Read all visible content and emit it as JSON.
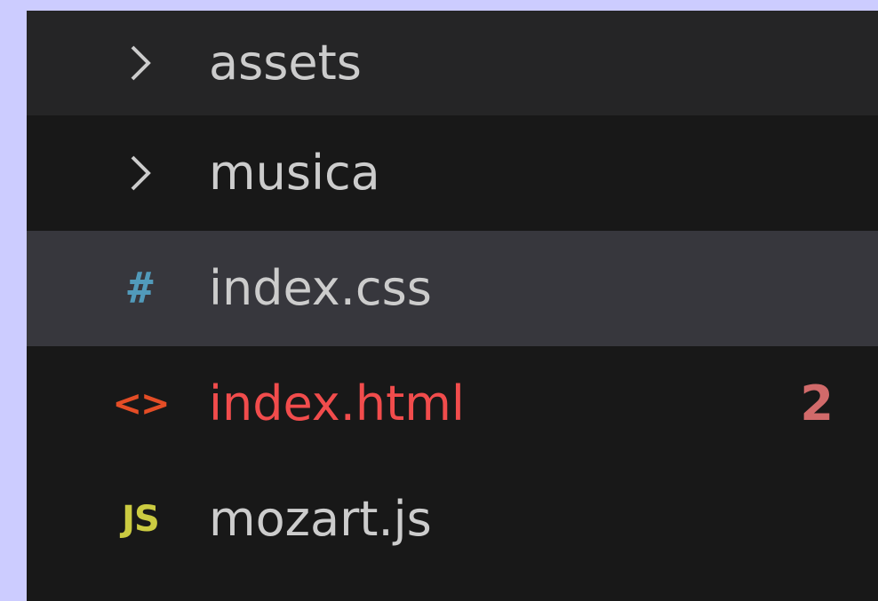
{
  "explorer": {
    "items": [
      {
        "label": "assets",
        "icon": "chevron-right-icon",
        "kind": "folder",
        "color": "#cccccc"
      },
      {
        "label": "musica",
        "icon": "chevron-right-icon",
        "kind": "folder",
        "color": "#cccccc"
      },
      {
        "label": "index.css",
        "icon": "css-file-icon",
        "icon_glyph": "#",
        "kind": "file",
        "color": "#cccccc",
        "icon_color": "#519aba",
        "selected": true
      },
      {
        "label": "index.html",
        "icon": "html-file-icon",
        "icon_glyph": "<>",
        "kind": "file",
        "color": "#f14c4c",
        "icon_color": "#e44d26",
        "badge": "2",
        "badge_color": "#d16a6a"
      },
      {
        "label": "mozart.js",
        "icon": "js-file-icon",
        "icon_glyph": "JS",
        "kind": "file",
        "color": "#cccccc",
        "icon_color": "#cbcb41"
      }
    ]
  },
  "colors": {
    "background": "#181818",
    "hover_row": "#252526",
    "selected_row": "#37373d",
    "frame": "#ccccff"
  }
}
